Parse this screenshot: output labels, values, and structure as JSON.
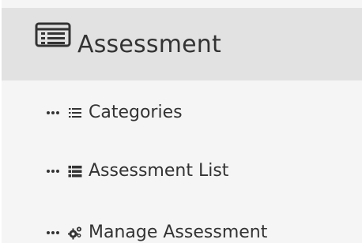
{
  "header": {
    "title": "Assessment",
    "icon": "list-alt-icon"
  },
  "menu": {
    "items": [
      {
        "label": "Categories",
        "icon": "list-icon"
      },
      {
        "label": "Assessment List",
        "icon": "bold-list-icon"
      },
      {
        "label": "Manage Assessment",
        "icon": "gears-icon"
      }
    ]
  }
}
